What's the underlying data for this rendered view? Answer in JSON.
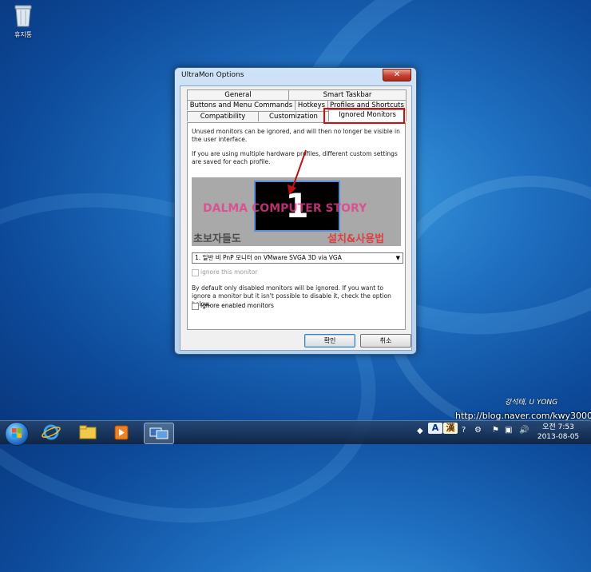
{
  "desktop": {
    "recycle_bin_label": "휴지통",
    "watermark_author": "강석태, U YONG",
    "watermark_url": "http://blog.naver.com/kwy3000"
  },
  "window": {
    "title": "UltraMon Options",
    "close_glyph": "✕",
    "tabs": {
      "row1": [
        "General",
        "Smart Taskbar"
      ],
      "row2": [
        "Buttons and Menu Commands",
        "Hotkeys",
        "Profiles and Shortcuts"
      ],
      "row3": [
        "Compatibility",
        "Customization",
        "Ignored Monitors"
      ]
    },
    "active_tab": "Ignored Monitors",
    "panel": {
      "desc1": "Unused monitors can be ignored, and will then no longer be visible in the user interface.",
      "desc2": "If you are using multiple hardware profiles, different custom settings are saved for each profile.",
      "monitor_number": "1",
      "overlay_dalma": "DALMA COMPUTER STORY",
      "overlay_kor_left": "초보자들도",
      "overlay_kor_right": "설치&사용법",
      "selected_monitor": "1. 일반 비 PnP 모니터 on VMware SVGA 3D via VGA",
      "ignore_this_label": "ignore this monitor",
      "ignore_this_checked": false,
      "desc3": "By default only disabled monitors will be ignored. If you want to ignore a monitor but it isn't possible to disable it, check the option below.",
      "ignore_enabled_label": "ignore enabled monitors",
      "ignore_enabled_checked": false
    },
    "ok_label": "확인",
    "cancel_label": "취소"
  },
  "taskbar": {
    "ime_label": "A",
    "ime_mode": "漢",
    "clock_time": "오전 7:53",
    "clock_date": "2013-08-05"
  },
  "colors": {
    "highlight": "#d01010",
    "monitor_border": "#5a8fd8"
  }
}
